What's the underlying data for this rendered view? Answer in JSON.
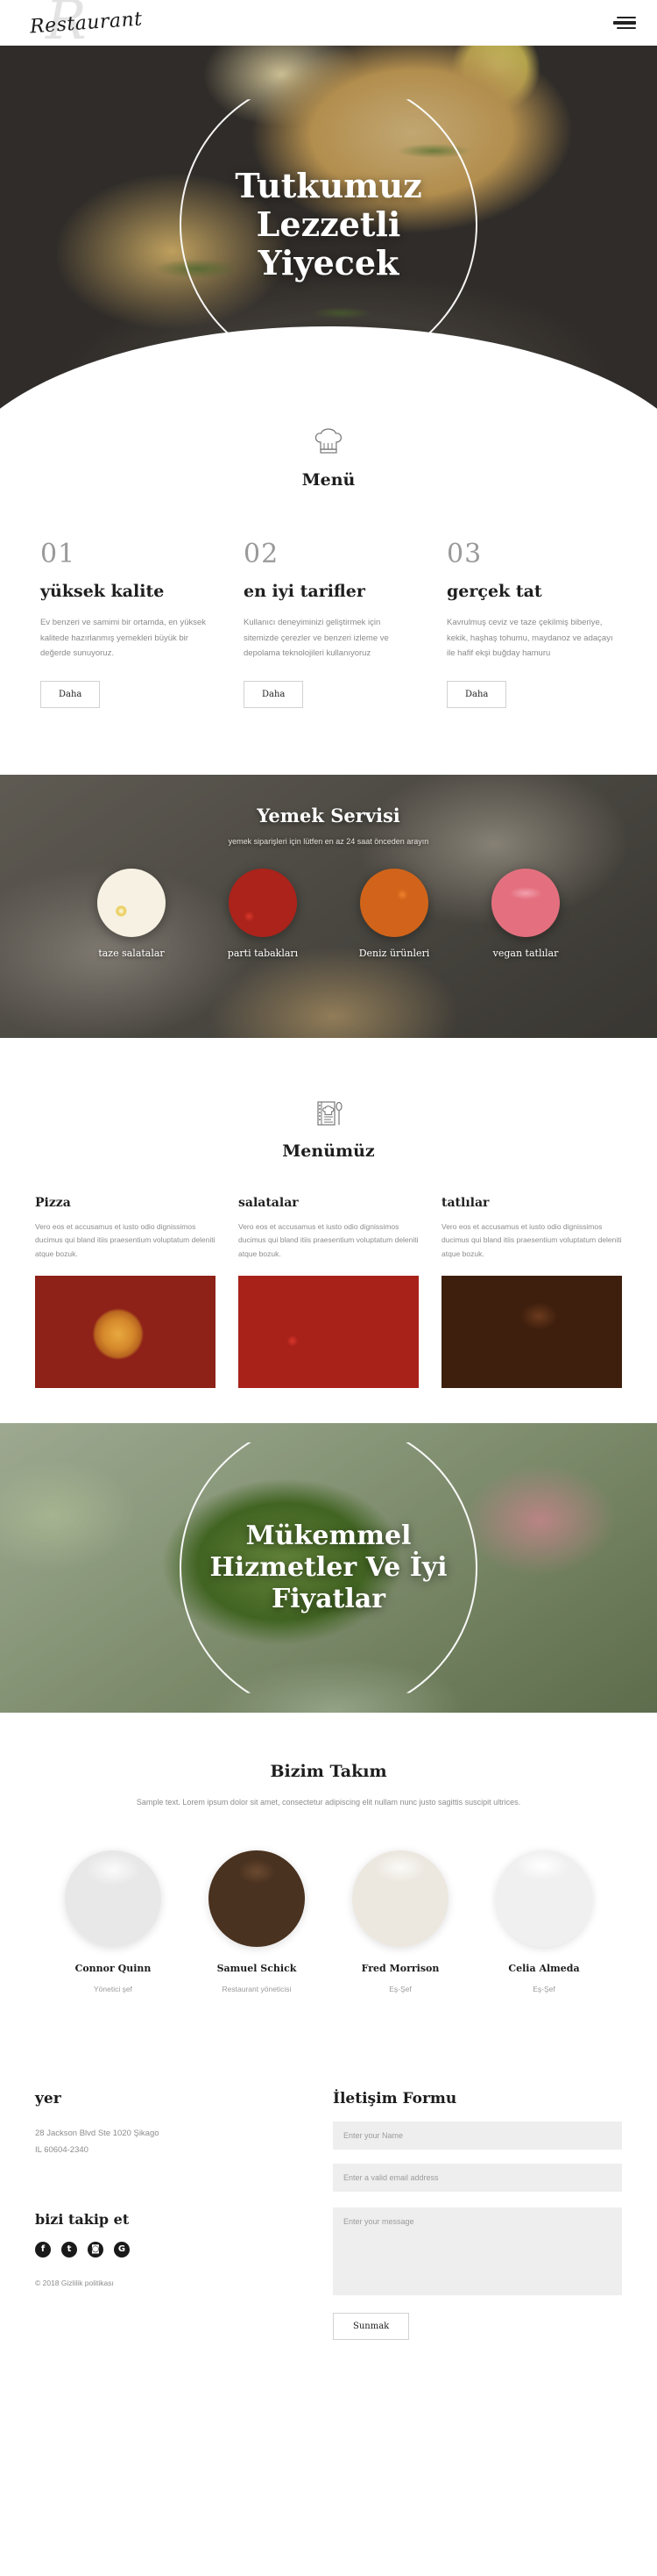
{
  "header": {
    "logo_text": "Restaurant",
    "logo_ghost": "R",
    "menu_icon": "hamburger-icon"
  },
  "hero": {
    "title_line1": "Tutkumuz",
    "title_line2": "Lezzetli",
    "title_line3": "Yiyecek"
  },
  "menu_section": {
    "icon": "chef-hat-icon",
    "title": "Menü",
    "features": [
      {
        "number": "01",
        "title": "yüksek kalite",
        "desc": "Ev benzeri ve samimi bir ortamda, en yüksek kalitede hazırlanmış yemekleri büyük bir değerde sunuyoruz.",
        "button": "Daha"
      },
      {
        "number": "02",
        "title": "en iyi tarifler",
        "desc": "Kullanıcı deneyiminizi geliştirmek için sitemizde çerezler ve benzeri izleme ve depolama teknolojileri kullanıyoruz",
        "button": "Daha"
      },
      {
        "number": "03",
        "title": "gerçek tat",
        "desc": "Kavrulmuş ceviz ve taze çekilmiş biberiye, kekik, haşhaş tohumu, maydanoz ve adaçayı ile hafif ekşi buğday hamuru",
        "button": "Daha"
      }
    ]
  },
  "service": {
    "title": "Yemek Servisi",
    "subtitle": "yemek siparişleri için lütfen en az 24 saat önceden arayın",
    "dishes": [
      {
        "label": "taze salatalar"
      },
      {
        "label": "parti tabakları"
      },
      {
        "label": "Deniz ürünleri"
      },
      {
        "label": "vegan tatlılar"
      }
    ]
  },
  "menu_grid": {
    "icon": "menu-book-spoon-icon",
    "title": "Menümüz",
    "columns": [
      {
        "title": "Pizza",
        "desc": "Vero eos et accusamus et iusto odio dignissimos ducimus qui bland itiis praesentium voluptatum deleniti atque bozuk."
      },
      {
        "title": "salatalar",
        "desc": "Vero eos et accusamus et iusto odio dignissimos ducimus qui bland itiis praesentium voluptatum deleniti atque bozuk."
      },
      {
        "title": "tatlılar",
        "desc": "Vero eos et accusamus et iusto odio dignissimos ducimus qui bland itiis praesentium voluptatum deleniti atque bozuk."
      }
    ]
  },
  "hero2": {
    "title_line1": "Mükemmel",
    "title_line2": "Hizmetler Ve İyi",
    "title_line3": "Fiyatlar"
  },
  "team": {
    "title": "Bizim Takım",
    "subtitle": "Sample text. Lorem ipsum dolor sit amet, consectetur adipiscing elit nullam nunc justo sagittis suscipit ultrices.",
    "members": [
      {
        "name": "Connor Quinn",
        "role": "Yönetici şef"
      },
      {
        "name": "Samuel Schick",
        "role": "Restaurant yöneticisi"
      },
      {
        "name": "Fred Morrison",
        "role": "Eş-Şef"
      },
      {
        "name": "Celia Almeda",
        "role": "Eş-Şef"
      }
    ]
  },
  "footer": {
    "location_title": "yer",
    "address_line1": "28 Jackson Blvd Ste 1020 Şikago",
    "address_line2": "IL 60604-2340",
    "follow_title": "bizi takip et",
    "socials": [
      {
        "name": "facebook-icon",
        "glyph": "f"
      },
      {
        "name": "twitter-icon",
        "glyph": "t"
      },
      {
        "name": "instagram-icon",
        "glyph": "◙"
      },
      {
        "name": "google-plus-icon",
        "glyph": "G"
      }
    ],
    "copyright": "© 2018 Gizlilik politikası",
    "form_title": "İletişim Formu",
    "name_placeholder": "Enter your Name",
    "email_placeholder": "Enter a valid email address",
    "message_placeholder": "Enter your message",
    "submit_label": "Sunmak"
  }
}
